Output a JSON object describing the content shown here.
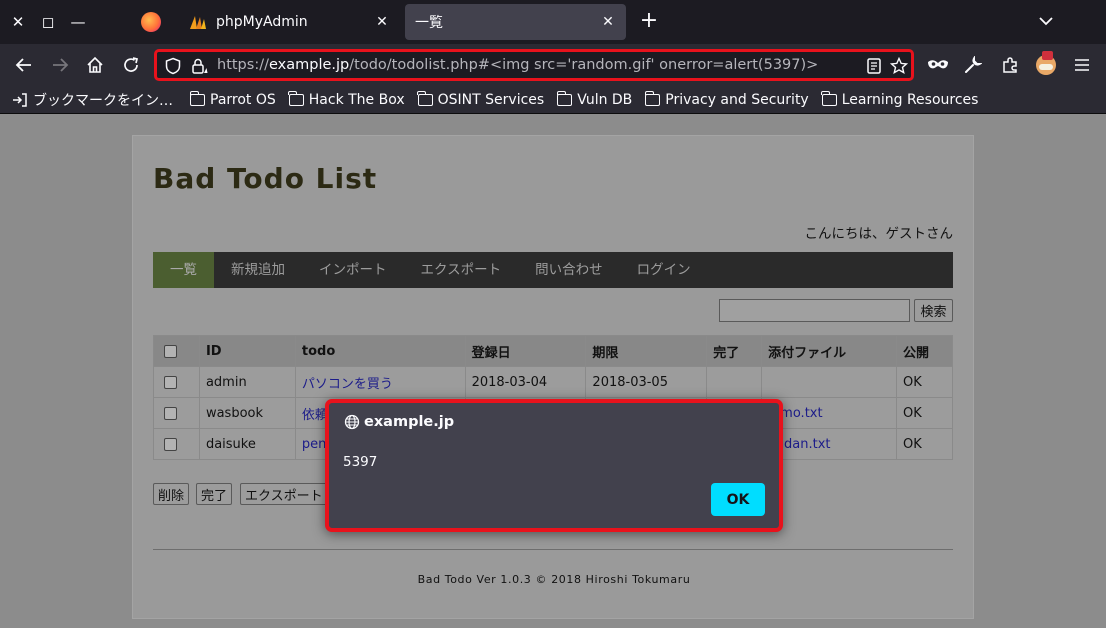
{
  "browser": {
    "tabs": [
      {
        "title": "phpMyAdmin",
        "active": false
      },
      {
        "title": "一覧",
        "active": true
      }
    ],
    "url": {
      "scheme": "https://",
      "domain": "example.jp",
      "path": "/todo/todolist.php#<img src='random.gif' onerror=alert(5397)>"
    },
    "bookmarks": [
      "ブックマークをイン…",
      "Parrot OS",
      "Hack The Box",
      "OSINT Services",
      "Vuln DB",
      "Privacy and Security",
      "Learning Resources"
    ],
    "colors": {
      "highlight_border": "#e8121c",
      "dialog_button": "#00ddff"
    }
  },
  "page": {
    "title": "Bad Todo List",
    "greeting": "こんにちは、ゲストさん",
    "menu": [
      "一覧",
      "新規追加",
      "インポート",
      "エクスポート",
      "問い合わせ",
      "ログイン"
    ],
    "search_button": "検索",
    "table": {
      "headers": [
        "ID",
        "todo",
        "登録日",
        "期限",
        "完了",
        "添付ファイル",
        "公開"
      ],
      "rows": [
        {
          "id": "admin",
          "todo": "パソコンを買う",
          "registered": "2018-03-04",
          "due": "2018-03-05",
          "done": "",
          "file": "",
          "public": "OK"
        },
        {
          "id": "wasbook",
          "todo": "依頼",
          "file": "emo.txt",
          "public": "OK"
        },
        {
          "id": "daisuke",
          "todo": "pen",
          "file": "indan.txt",
          "public": "OK"
        }
      ]
    },
    "actions": [
      "削除",
      "完了",
      "エクスポート"
    ],
    "footer": "Bad Todo Ver 1.0.3 © 2018 Hiroshi Tokumaru"
  },
  "dialog": {
    "origin": "example.jp",
    "message": "5397",
    "ok_label": "OK"
  }
}
